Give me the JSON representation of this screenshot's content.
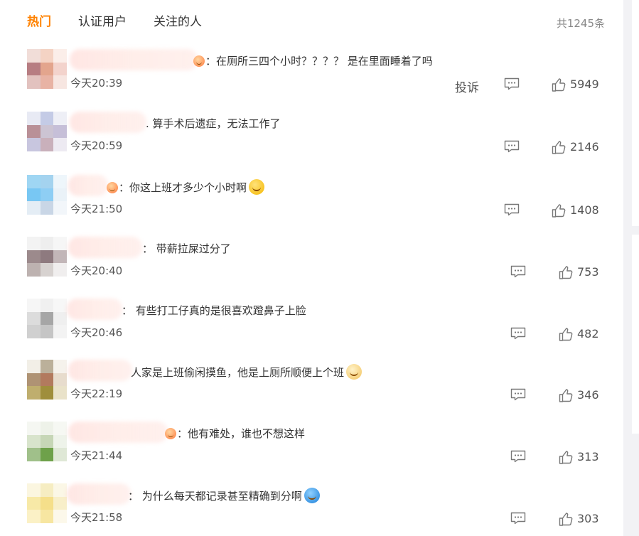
{
  "tabs": [
    {
      "label": "热门",
      "active": true
    },
    {
      "label": "认证用户",
      "active": false
    },
    {
      "label": "关注的人",
      "active": false
    }
  ],
  "total": "共1245条",
  "report_label": "投诉",
  "accent_color": "#ff8200",
  "comments": [
    {
      "text": "在厕所三四个小时？？？？ 是在里面睡着了吗",
      "time": "今天20:39",
      "likes": "5949",
      "show_report": true,
      "emoji": null
    },
    {
      "text": "算手术后遗症，无法工作了",
      "time": "今天20:59",
      "likes": "2146",
      "show_report": false,
      "emoji": null
    },
    {
      "text": "你这上班才多少个小时啊",
      "time": "今天21:50",
      "likes": "1408",
      "show_report": false,
      "emoji": "laughing-tears-emoji"
    },
    {
      "text": "带薪拉屎过分了",
      "time": "今天20:40",
      "likes": "753",
      "show_report": false,
      "emoji": null
    },
    {
      "text": "有些打工仔真的是很喜欢蹬鼻子上脸",
      "time": "今天20:46",
      "likes": "482",
      "show_report": false,
      "emoji": null
    },
    {
      "text": "人家是上班偷闲摸鱼，他是上厕所顺便上个班",
      "time": "今天22:19",
      "likes": "346",
      "show_report": false,
      "emoji": "doge-emoji"
    },
    {
      "text": "他有难处，谁也不想这样",
      "time": "今天21:44",
      "likes": "313",
      "show_report": false,
      "emoji": null
    },
    {
      "text": "为什么每天都记录甚至精确到分啊",
      "time": "今天21:58",
      "likes": "303",
      "show_report": false,
      "emoji": "doraemon-emoji"
    }
  ]
}
